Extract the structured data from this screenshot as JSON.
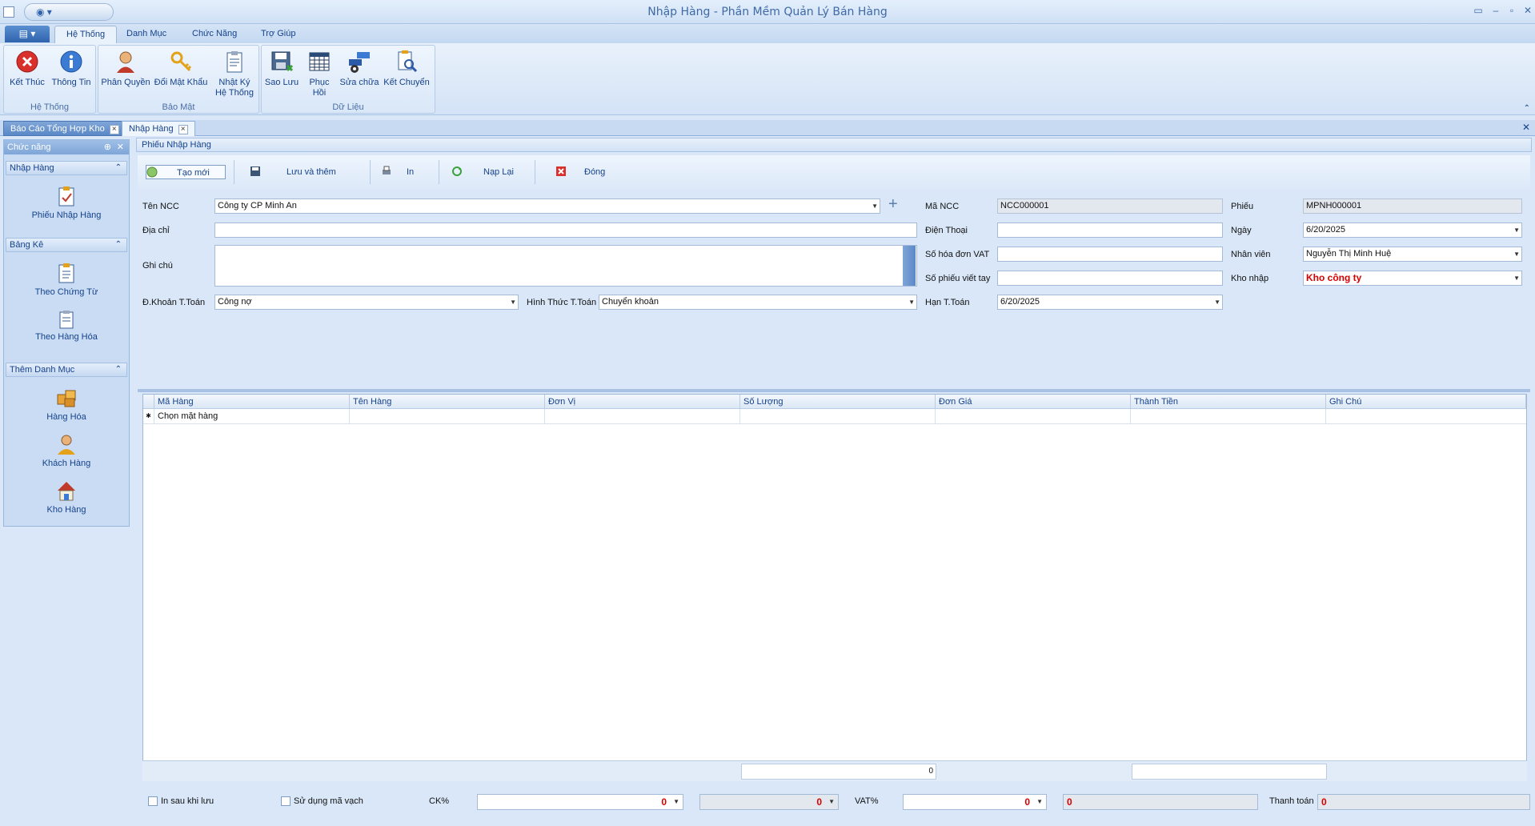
{
  "window": {
    "title": "Nhập Hàng - Phần Mềm Quản Lý Bán Hàng",
    "controls": [
      "▭",
      "–",
      "▫",
      "✕"
    ]
  },
  "menu_tabs": [
    "Hệ Thống",
    "Danh Mục",
    "Chức Năng",
    "Trợ Giúp"
  ],
  "ribbon": {
    "groups": [
      {
        "title": "Hệ Thống",
        "buttons": [
          "Kết Thúc",
          "Thông Tin"
        ]
      },
      {
        "title": "Bảo Mật",
        "buttons": [
          "Phân Quyền",
          "Đổi Mật Khẩu",
          "Nhật Ký Hệ Thống"
        ]
      },
      {
        "title": "Dữ Liệu",
        "buttons": [
          "Sao Lưu",
          "Phục Hồi",
          "Sửa chữa",
          "Kết Chuyển"
        ]
      }
    ]
  },
  "doc_tabs": [
    "Báo Cáo Tổng Hợp Kho",
    "Nhập Hàng"
  ],
  "left_panel": {
    "header": "Chức năng",
    "sections": [
      {
        "title": "Nhập Hàng",
        "items": [
          "Phiếu Nhập Hàng"
        ]
      },
      {
        "title": "Bảng Kê",
        "items": [
          "Theo Chứng Từ",
          "Theo Hàng Hóa"
        ]
      },
      {
        "title": "Thêm Danh Mục",
        "items": [
          "Hàng Hóa",
          "Khách Hàng",
          "Kho Hàng"
        ]
      }
    ]
  },
  "form": {
    "title": "Phiếu Nhập Hàng",
    "toolbar": [
      "Tạo mới",
      "Lưu và thêm",
      "In",
      "Nạp Lại",
      "Đóng"
    ],
    "labels": {
      "ten_ncc": "Tên NCC",
      "dia_chi": "Địa chỉ",
      "ghi_chu": "Ghi chú",
      "dkhoan": "Đ.Khoản T.Toán",
      "hinh_thuc": "Hình Thức T.Toán",
      "ma_ncc": "Mã NCC",
      "dien_thoai": "Điện Thoại",
      "so_hoa_don": "Số hóa đơn VAT",
      "so_phieu_viet_tay": "Số phiếu viết tay",
      "han_ttoan": "Hạn T.Toán",
      "phieu": "Phiếu",
      "ngay": "Ngày",
      "nhan_vien": "Nhân viên",
      "kho_nhap": "Kho nhập"
    },
    "values": {
      "ten_ncc": "Công ty CP Minh An",
      "dia_chi": "",
      "ghi_chu": "",
      "dkhoan": "Công nợ",
      "hinh_thuc": "Chuyển khoản",
      "ma_ncc": "NCC000001",
      "dien_thoai": "",
      "so_hoa_don": "",
      "so_phieu_viet_tay": "",
      "han_ttoan": "6/20/2025",
      "phieu": "MPNH000001",
      "ngay": "6/20/2025",
      "nhan_vien": "Nguyễn Thị Minh  Huệ",
      "kho_nhap": "Kho công ty"
    }
  },
  "grid": {
    "columns": [
      "Mã Hàng",
      "Tên Hàng",
      "Đơn Vị",
      "Số Lượng",
      "Đơn Giá",
      "Thành Tiền",
      "Ghi Chú"
    ],
    "new_row_placeholder": "Chọn mặt hàng",
    "footer_total": "0"
  },
  "bottom": {
    "in_sau_khi_luu": "In sau khi lưu",
    "su_dung_ma_vach": "Sử dụng mã vạch",
    "ck_label": "CK%",
    "ck_value": "0",
    "ck_amount": "0",
    "vat_label": "VAT%",
    "vat_value": "0",
    "vat_amount": "0",
    "thanh_toan_label": "Thanh toán",
    "thanh_toan_value": "0"
  },
  "colors": {
    "accent": "#15428b",
    "ribbon_bg": "#d3e3f6",
    "alert_red": "#d90000"
  }
}
